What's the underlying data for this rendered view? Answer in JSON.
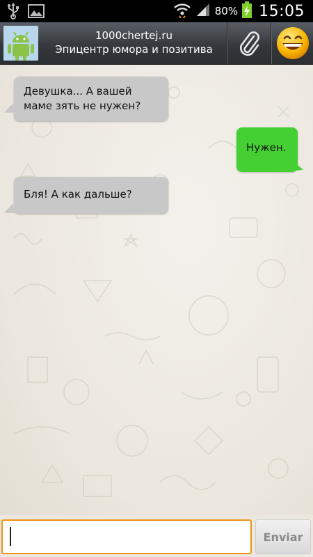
{
  "status_bar": {
    "battery_percent": "80%",
    "time": "15:05",
    "icons": [
      "usb-icon",
      "gallery-icon",
      "wifi-icon",
      "signal-icon",
      "battery-icon"
    ]
  },
  "header": {
    "title": "1000chertej.ru",
    "subtitle": "Эпицентр юмора и позитива",
    "icons": [
      "android-avatar-icon",
      "paperclip-icon",
      "smiley-icon"
    ]
  },
  "messages": [
    {
      "direction": "incoming",
      "text": "Девушка... А вашей маме зять не нужен?"
    },
    {
      "direction": "outgoing",
      "text": "Нужен."
    },
    {
      "direction": "incoming",
      "text": "Бля! А как дальше?"
    }
  ],
  "composer": {
    "value": "",
    "send_label": "Enviar"
  },
  "colors": {
    "outgoing_bubble": "#44cf33",
    "incoming_bubble": "#c8c8c8",
    "input_focus_border": "#f09412",
    "header_bg": "#35393e"
  }
}
